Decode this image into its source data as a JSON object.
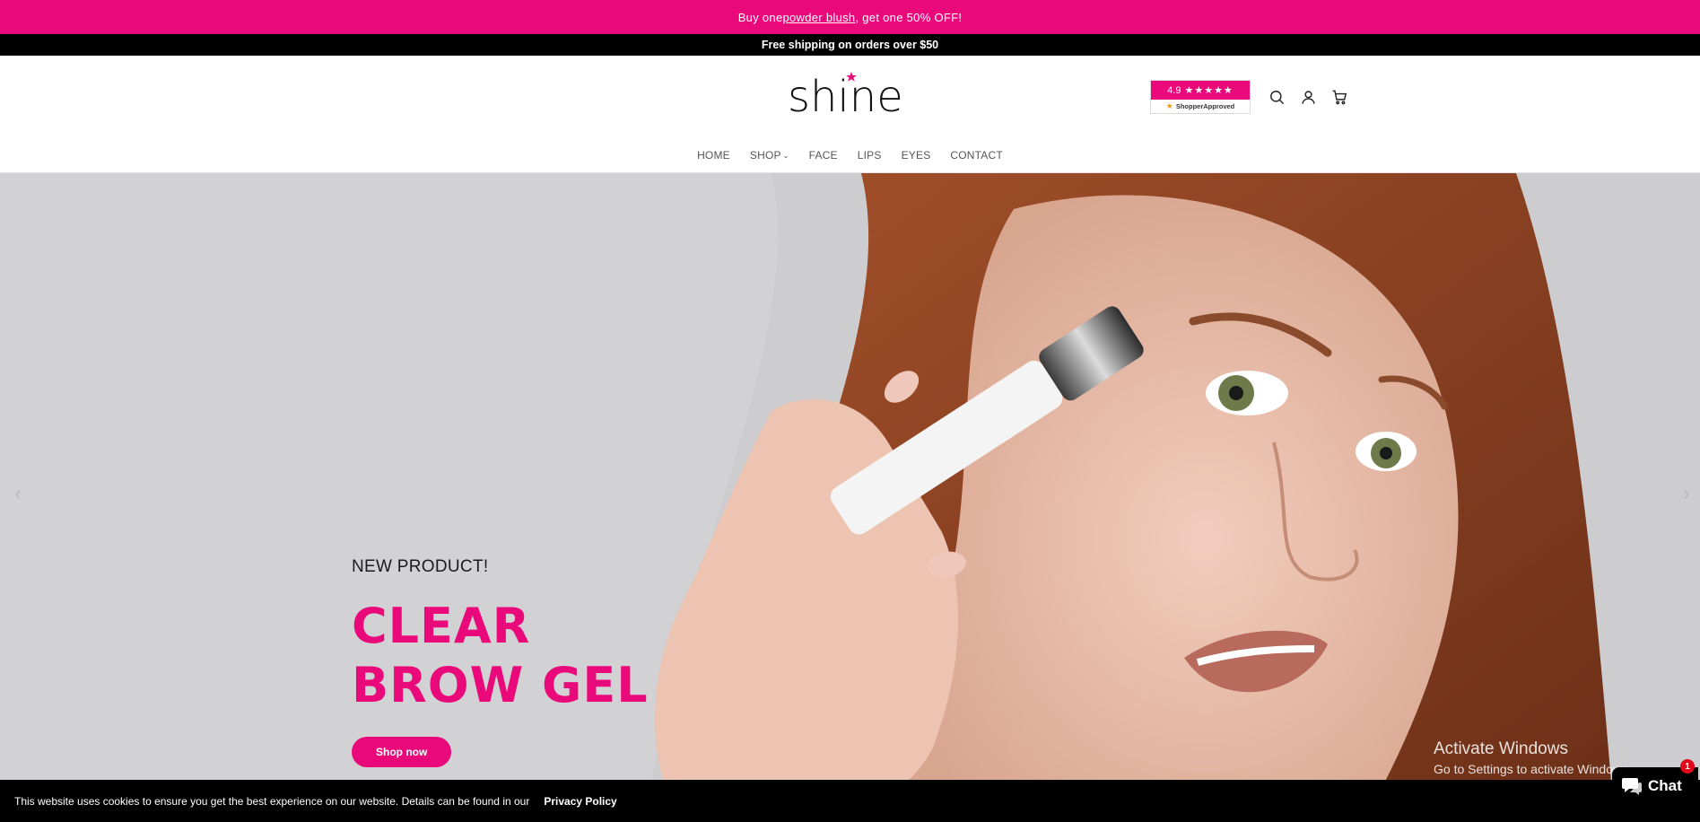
{
  "promo": {
    "before": "Buy one ",
    "link": "powder blush",
    "after": ", get one 50% OFF!"
  },
  "shipping": "Free shipping on orders over $50",
  "logo": {
    "text": "shine"
  },
  "rating": {
    "score": "4.9",
    "stars": "★★★★★",
    "provider": "ShopperApproved"
  },
  "header_icons": [
    "search-icon",
    "account-icon",
    "cart-icon"
  ],
  "nav": {
    "items": [
      {
        "label": "HOME"
      },
      {
        "label": "SHOP",
        "dropdown": true
      },
      {
        "label": "FACE"
      },
      {
        "label": "LIPS"
      },
      {
        "label": "EYES"
      },
      {
        "label": "CONTACT"
      }
    ]
  },
  "hero": {
    "eyebrow": "NEW PRODUCT!",
    "headline_line1": "CLEAR",
    "headline_line2": "BROW GEL",
    "cta": "Shop now",
    "prev": "‹",
    "next": "›"
  },
  "watermark": {
    "line1": "Activate Windows",
    "line2": "Go to Settings to activate Windows."
  },
  "cookie": {
    "text": "This website uses cookies to ensure you get the best experience on our website. Details can be found in our",
    "policy": "Privacy Policy"
  },
  "chat": {
    "label": "Chat",
    "badge": "1"
  },
  "colors": {
    "brand_pink": "#e9097a",
    "bar_black": "#000000",
    "hero_bg": "#d2d1d3"
  }
}
